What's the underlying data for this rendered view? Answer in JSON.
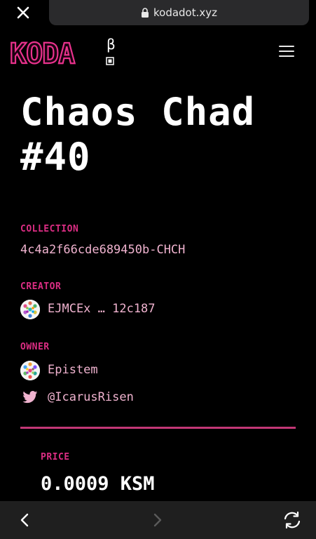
{
  "browser": {
    "url": "kodadot.xyz",
    "close_icon": "close-icon",
    "lock_icon": "lock-icon"
  },
  "header": {
    "logo_text": "KODA",
    "beta_symbol": "β",
    "menu_icon": "hamburger-menu-icon"
  },
  "nft": {
    "title": "Chaos Chad #40",
    "collection_label": "COLLECTION",
    "collection_value": "4c4a2f66cde689450b-CHCH",
    "creator_label": "CREATOR",
    "creator_value": "EJMCEx … 12c187",
    "owner_label": "OWNER",
    "owner_value": "Epistem",
    "owner_twitter": "@IcarusRisen",
    "price_label": "PRICE",
    "price_value": "0.0009 KSM"
  },
  "bottom_bar": {
    "back_icon": "chevron-left-icon",
    "forward_icon": "chevron-right-icon",
    "refresh_icon": "refresh-icon"
  },
  "colors": {
    "accent": "#db2d83",
    "value_text": "#f0b3cf",
    "divider": "#c23776",
    "background": "#000000"
  }
}
